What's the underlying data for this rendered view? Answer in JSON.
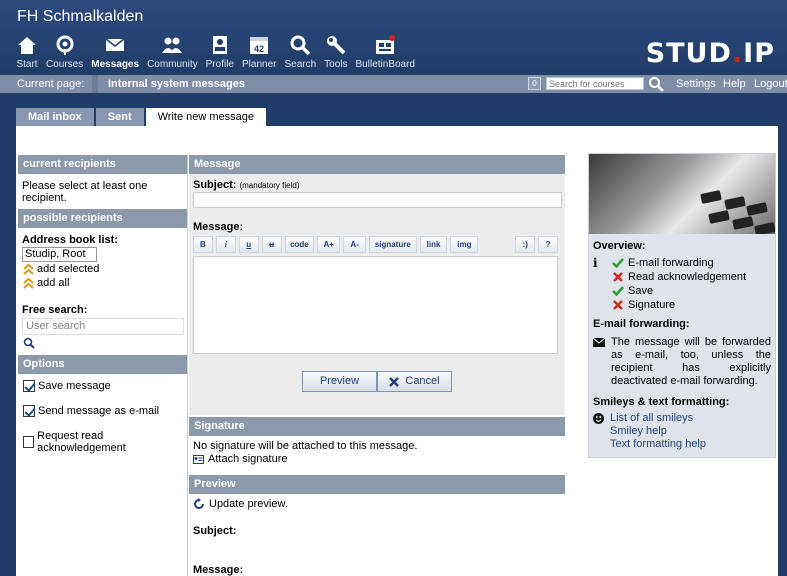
{
  "site_title": "FH Schmalkalden",
  "logo": {
    "left": "STUD",
    "dot": ".",
    "right": "IP"
  },
  "nav": [
    {
      "label": "Start",
      "icon": "home-icon"
    },
    {
      "label": "Courses",
      "icon": "courses-icon"
    },
    {
      "label": "Messages",
      "icon": "envelope-icon",
      "active": true
    },
    {
      "label": "Community",
      "icon": "community-icon"
    },
    {
      "label": "Profile",
      "icon": "profile-icon"
    },
    {
      "label": "Planner",
      "icon": "calendar-icon",
      "day": "42"
    },
    {
      "label": "Search",
      "icon": "search-icon"
    },
    {
      "label": "Tools",
      "icon": "wrench-icon"
    },
    {
      "label": "BulletinBoard",
      "icon": "bulletinboard-icon"
    }
  ],
  "breadcrumb": {
    "label": "Current page:",
    "value": "Internal system messages"
  },
  "topbar": {
    "counter": "0",
    "search_placeholder": "Search for courses",
    "settings": "Settings",
    "help": "Help",
    "logout": "Logout"
  },
  "tabs": [
    "Mail inbox",
    "Sent",
    "Write new message"
  ],
  "left": {
    "current_recipients_title": "current recipients",
    "current_recipients_note": "Please select at least one recipient.",
    "possible_recipients_title": "possible recipients",
    "address_book_label": "Address book list:",
    "address_book_entry": "Studip, Root",
    "add_selected": "add selected",
    "add_all": "add all",
    "free_search_label": "Free search:",
    "user_search_placeholder": "User search",
    "options_title": "Options",
    "options": [
      {
        "label": "Save message",
        "checked": true
      },
      {
        "label": "Send message as e-mail",
        "checked": true
      },
      {
        "label": "Request read acknowledgement",
        "checked": false
      }
    ]
  },
  "message": {
    "title": "Message",
    "subject_label": "Subject:",
    "subject_hint": "(mandatory field)",
    "message_label": "Message:",
    "toolbar": [
      "B",
      "i",
      "u",
      "u",
      "code",
      "A+",
      "A-",
      "signature",
      "link",
      "img"
    ],
    "toolbar_right": [
      ":)",
      "?"
    ],
    "preview_button": "Preview",
    "cancel_button": "Cancel"
  },
  "signature": {
    "title": "Signature",
    "note": "No signature will be attached to this message.",
    "attach": "Attach signature"
  },
  "preview": {
    "title": "Preview",
    "update": "Update preview.",
    "subject_label": "Subject:",
    "message_label": "Message:"
  },
  "sidebar": {
    "overview_title": "Overview:",
    "overview_items": [
      {
        "label": "E-mail forwarding",
        "state": "yes"
      },
      {
        "label": "Read acknowledgement",
        "state": "no"
      },
      {
        "label": "Save",
        "state": "yes"
      },
      {
        "label": "Signature",
        "state": "no"
      }
    ],
    "forwarding_title": "E-mail forwarding:",
    "forwarding_text": "The message will be forwarded as e-mail, too, unless the recipient has explicitly deactivated e-mail forwarding.",
    "smileys_title": "Smileys & text formatting:",
    "smiley_links": [
      "List of all smileys",
      "Smiley help",
      "Text formatting help"
    ]
  },
  "colors": {
    "header": "#203c68",
    "bar": "#8a9aab",
    "yes": "#2e9c2e",
    "no": "#d42a1e"
  }
}
